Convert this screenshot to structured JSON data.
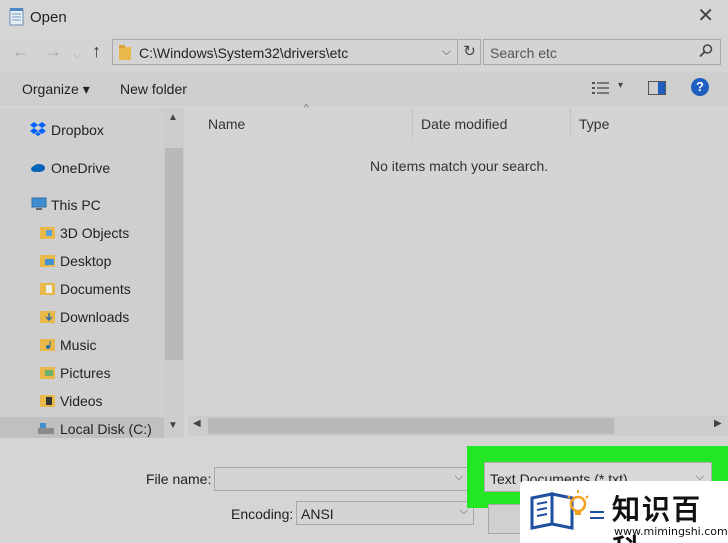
{
  "window": {
    "title": "Open",
    "close_glyph": "✕"
  },
  "address_bar": {
    "path": "C:\\Windows\\System32\\drivers\\etc",
    "back_glyph": "←",
    "forward_glyph": "→",
    "up_glyph": "↑",
    "refresh_glyph": "↻",
    "dropdown_glyph": "⌵"
  },
  "search": {
    "placeholder": "Search etc"
  },
  "toolbar": {
    "organize_label": "Organize ▾",
    "new_folder_label": "New folder",
    "help_label": "?",
    "view_dropdown_glyph": "▾"
  },
  "nav_pane": {
    "items": [
      {
        "label": "Dropbox",
        "icon": "dropbox-icon"
      },
      {
        "label": "OneDrive",
        "icon": "cloud-icon"
      },
      {
        "label": "This PC",
        "icon": "computer-icon"
      },
      {
        "label": "3D Objects",
        "icon": "folder-icon"
      },
      {
        "label": "Desktop",
        "icon": "folder-icon"
      },
      {
        "label": "Documents",
        "icon": "folder-icon"
      },
      {
        "label": "Downloads",
        "icon": "folder-icon"
      },
      {
        "label": "Music",
        "icon": "folder-icon"
      },
      {
        "label": "Pictures",
        "icon": "folder-icon"
      },
      {
        "label": "Videos",
        "icon": "folder-icon"
      },
      {
        "label": "Local Disk (C:)",
        "icon": "drive-icon"
      }
    ],
    "scroll_up_glyph": "▲",
    "scroll_down_glyph": "▼"
  },
  "file_list": {
    "columns": [
      "Name",
      "Date modified",
      "Type"
    ],
    "sort_glyph": "^",
    "empty_message": "No items match your search.",
    "scroll_left_glyph": "◀",
    "scroll_right_glyph": "▶"
  },
  "bottom": {
    "file_name_label": "File name:",
    "file_name_value": "",
    "encoding_label": "Encoding:",
    "encoding_value": "ANSI",
    "file_type_value": "Text Documents (*.txt)",
    "dropdown_glyph": "⌵"
  },
  "watermark": {
    "text": "知识百科",
    "url": "www.mimingshi.com"
  },
  "colors": {
    "highlight": "#23e624",
    "help_blue": "#1e5fbf",
    "folder_yellow": "#e8b94a",
    "dropbox_blue": "#0061fe"
  }
}
